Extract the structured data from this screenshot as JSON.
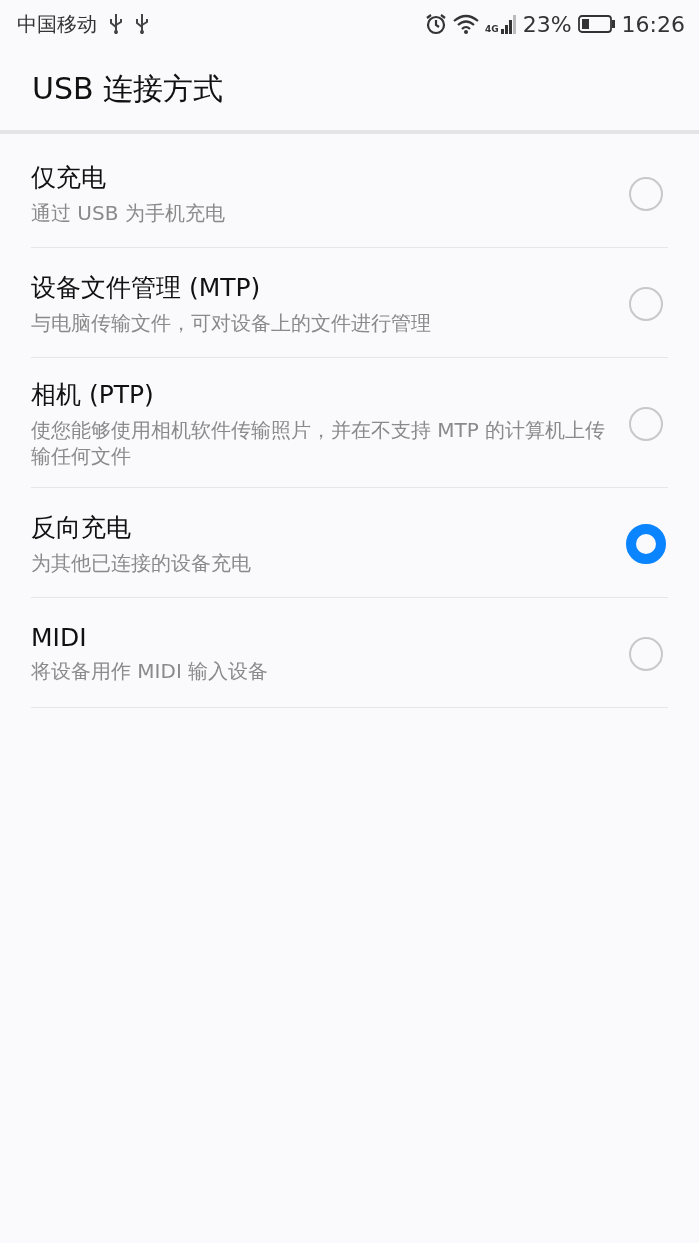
{
  "status_bar": {
    "carrier": "中国移动",
    "network": "4G",
    "battery": "23%",
    "time": "16:26"
  },
  "header": {
    "title": "USB 连接方式"
  },
  "options": [
    {
      "title": "仅充电",
      "subtitle": "通过 USB 为手机充电",
      "selected": false
    },
    {
      "title": "设备文件管理 (MTP)",
      "subtitle": "与电脑传输文件，可对设备上的文件进行管理",
      "selected": false
    },
    {
      "title": "相机 (PTP)",
      "subtitle": "使您能够使用相机软件传输照片，并在不支持 MTP 的计算机上传输任何文件",
      "selected": false
    },
    {
      "title": "反向充电",
      "subtitle": "为其他已连接的设备充电",
      "selected": true
    },
    {
      "title": "MIDI",
      "subtitle": "将设备用作 MIDI 输入设备",
      "selected": false
    }
  ]
}
